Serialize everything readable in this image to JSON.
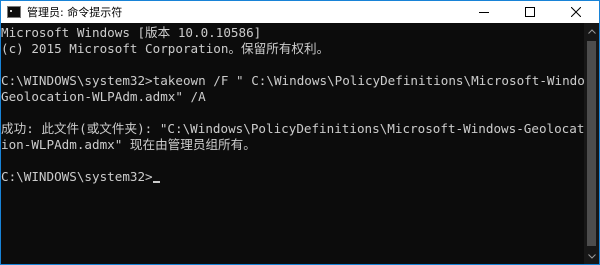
{
  "window": {
    "title": "管理员: 命令提示符",
    "icon": "terminal-icon",
    "controls": [
      "minimize-icon",
      "maximize-icon",
      "close-icon"
    ],
    "accent_color": "#1883d7"
  },
  "console": {
    "text_color": "#cccccc",
    "background": "#0c0c0c",
    "lines": [
      "Microsoft Windows [版本 10.0.10586]",
      "(c) 2015 Microsoft Corporation。保留所有权利。",
      "",
      "C:\\WINDOWS\\system32>takeown /F \" C:\\Windows\\PolicyDefinitions\\Microsoft-Windows-",
      "Geolocation-WLPAdm.admx\" /A",
      "",
      "成功: 此文件(或文件夹): \"C:\\Windows\\PolicyDefinitions\\Microsoft-Windows-Geolocat",
      "ion-WLPAdm.admx\" 现在由管理员组所有。",
      "",
      "C:\\WINDOWS\\system32>"
    ]
  }
}
